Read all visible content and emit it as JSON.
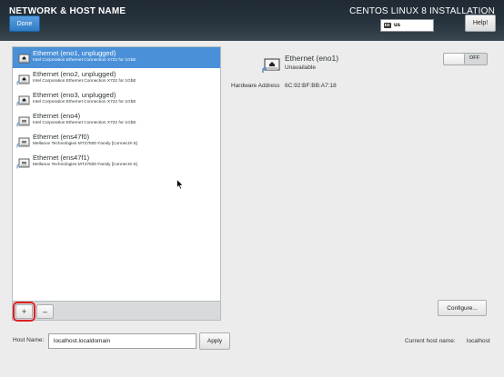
{
  "header": {
    "title": "NETWORK & HOST NAME",
    "product": "CENTOS LINUX 8 INSTALLATION",
    "done_label": "Done",
    "keyboard_layout": "us",
    "help_label": "Help!"
  },
  "devices": [
    {
      "name": "Ethernet (eno1, unplugged)",
      "sub": "Intel Corporation Ethernet Connection X722 for 1GbE",
      "icon": "ethernet-unplugged-icon",
      "selected": true
    },
    {
      "name": "Ethernet (eno2, unplugged)",
      "sub": "Intel Corporation Ethernet Connection X722 for 1GbE",
      "icon": "ethernet-unplugged-icon",
      "selected": false
    },
    {
      "name": "Ethernet (eno3, unplugged)",
      "sub": "Intel Corporation Ethernet Connection X722 for 1GbE",
      "icon": "ethernet-unplugged-icon",
      "selected": false
    },
    {
      "name": "Ethernet (eno4)",
      "sub": "Intel Corporation Ethernet Connection X722 for 1GbE",
      "icon": "ethernet-icon",
      "selected": false
    },
    {
      "name": "Ethernet (ens47f0)",
      "sub": "Mellanox Technologies MT27800 Family [ConnectX-5]",
      "icon": "ethernet-icon",
      "selected": false
    },
    {
      "name": "Ethernet (ens47f1)",
      "sub": "Mellanox Technologies MT27800 Family [ConnectX-5]",
      "icon": "ethernet-icon",
      "selected": false
    }
  ],
  "toolbar": {
    "add_label": "+",
    "remove_label": "–"
  },
  "detail": {
    "name": "Ethernet (eno1)",
    "status": "Unavailable",
    "hw_label": "Hardware Address",
    "hw_value": "6C:92:BF:BB:A7:18",
    "switch_label": "OFF",
    "switch_on": false,
    "configure_label": "Configure..."
  },
  "hostname": {
    "label": "Host Name:",
    "value": "localhost.localdomain",
    "apply_label": "Apply",
    "current_label": "Current host name:",
    "current_value": "localhost"
  },
  "colors": {
    "selection": "#4a90d9",
    "header": "#27333d",
    "done_button": "#3b87d1",
    "highlight": "#e02020"
  }
}
